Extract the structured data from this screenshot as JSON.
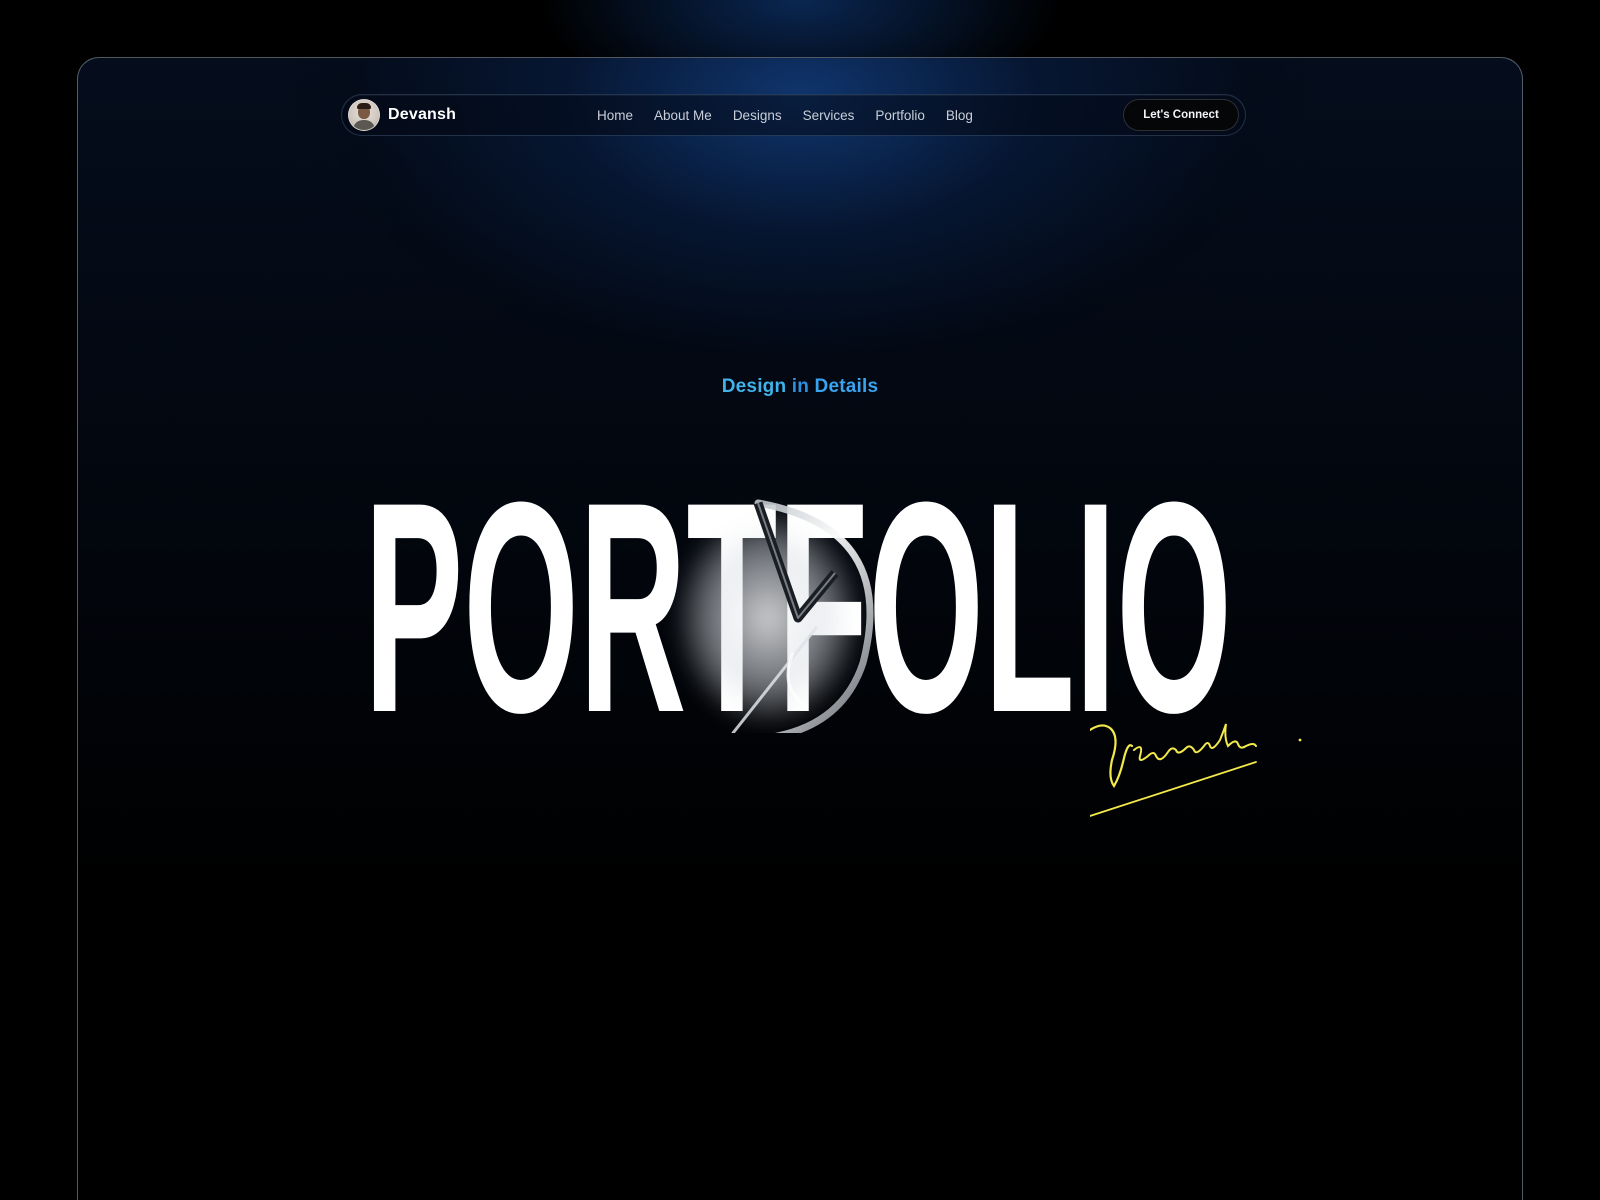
{
  "brand": {
    "name": "Devansh",
    "avatar_icon": "profile-photo"
  },
  "nav": {
    "links": [
      "Home",
      "About Me",
      "Designs",
      "Services",
      "Portfolio",
      "Blog"
    ],
    "cta_label": "Let's Connect"
  },
  "hero": {
    "eyebrow": {
      "word1": "Design",
      "word2": " in ",
      "word3": "Details"
    },
    "title": "PORTFOLIO",
    "signature": "Devansh"
  },
  "colors": {
    "background": "#000000",
    "glow": "#164ea0",
    "eyebrow_accent": "#3fb3ea",
    "title": "#ffffff",
    "signature": "#f3e94a"
  }
}
